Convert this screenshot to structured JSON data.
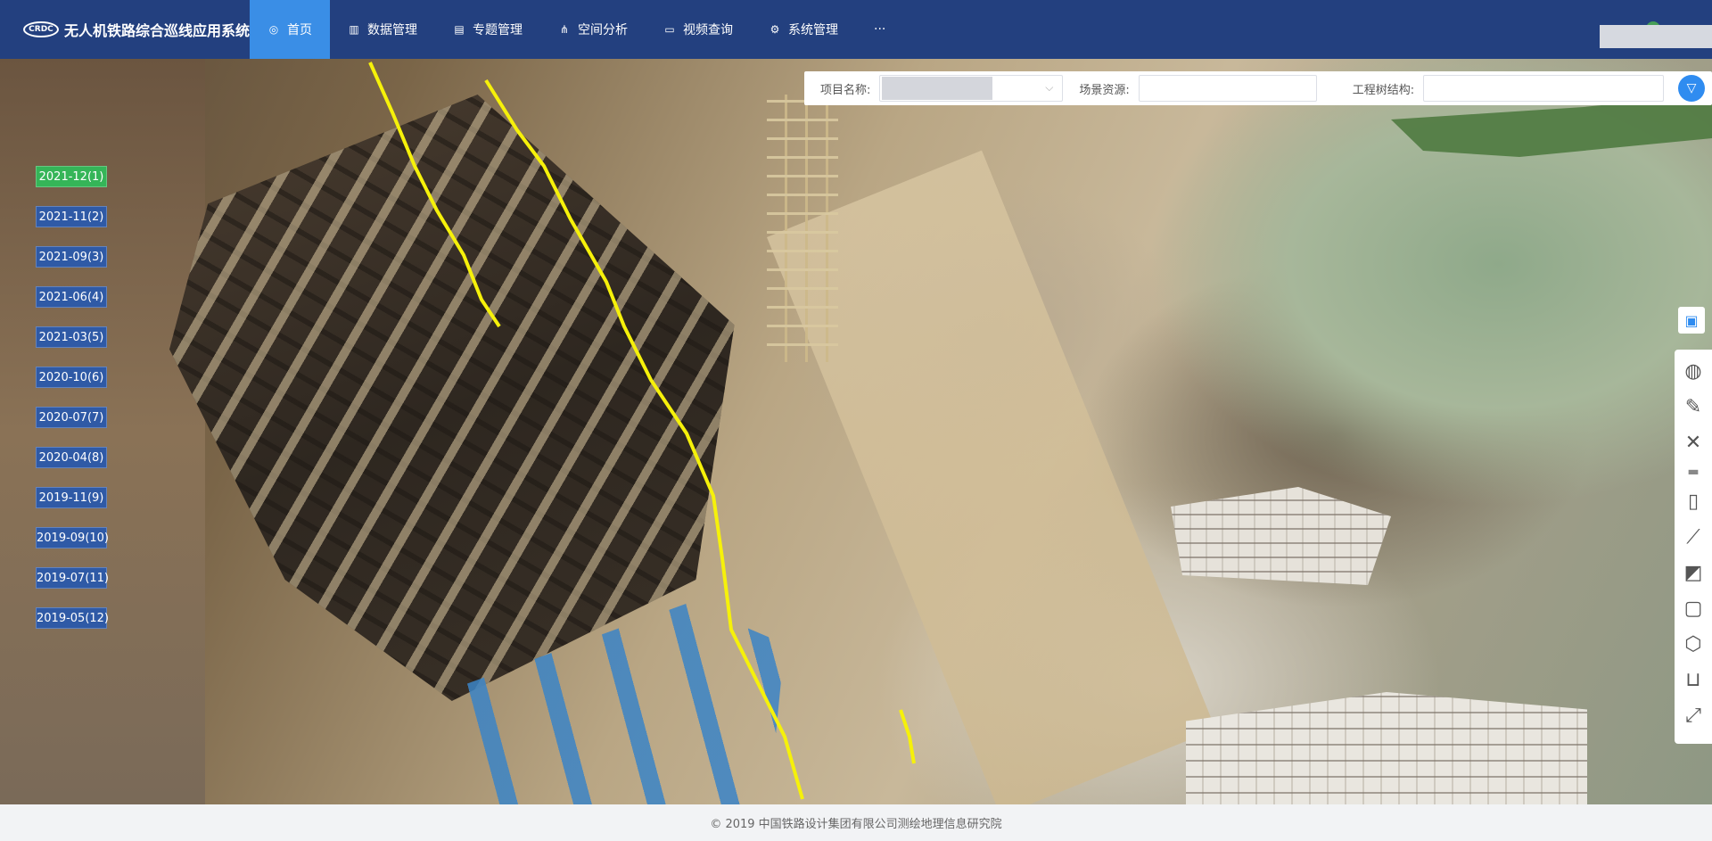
{
  "header": {
    "logo_mark": "CRDC",
    "title": "无人机铁路综合巡线应用系统",
    "nav": [
      {
        "label": "首页",
        "icon": "globe-icon",
        "active": true
      },
      {
        "label": "数据管理",
        "icon": "bar-chart-icon"
      },
      {
        "label": "专题管理",
        "icon": "document-icon"
      },
      {
        "label": "空间分析",
        "icon": "network-icon"
      },
      {
        "label": "视频查询",
        "icon": "video-icon"
      },
      {
        "label": "系统管理",
        "icon": "gear-icon"
      },
      {
        "label": "···",
        "icon": "more-icon"
      }
    ]
  },
  "timeline": [
    {
      "label": "2021-12(1)",
      "active": true
    },
    {
      "label": "2021-11(2)"
    },
    {
      "label": "2021-09(3)"
    },
    {
      "label": "2021-06(4)"
    },
    {
      "label": "2021-03(5)"
    },
    {
      "label": "2020-10(6)"
    },
    {
      "label": "2020-07(7)"
    },
    {
      "label": "2020-04(8)"
    },
    {
      "label": "2019-11(9)"
    },
    {
      "label": "2019-09(10)"
    },
    {
      "label": "2019-07(11)"
    },
    {
      "label": "2019-05(12)"
    }
  ],
  "filter": {
    "project_label": "项目名称:",
    "scene_label": "场景资源:",
    "scene_value": "",
    "structure_label": "工程树结构:",
    "structure_value": ""
  },
  "toolbar": {
    "toolbox_icon": "toolbox-icon",
    "tools": [
      "globe-icon",
      "pencil-icon",
      "clear-icon",
      "ruler-icon",
      "vertical-ruler-icon",
      "measure-icon",
      "area-icon",
      "3d-box-icon",
      "cube-icon",
      "basket-icon",
      "fullscreen-icon"
    ]
  },
  "footer": {
    "copyright": "© 2019 中国铁路设计集团有限公司测绘地理信息研究院"
  }
}
